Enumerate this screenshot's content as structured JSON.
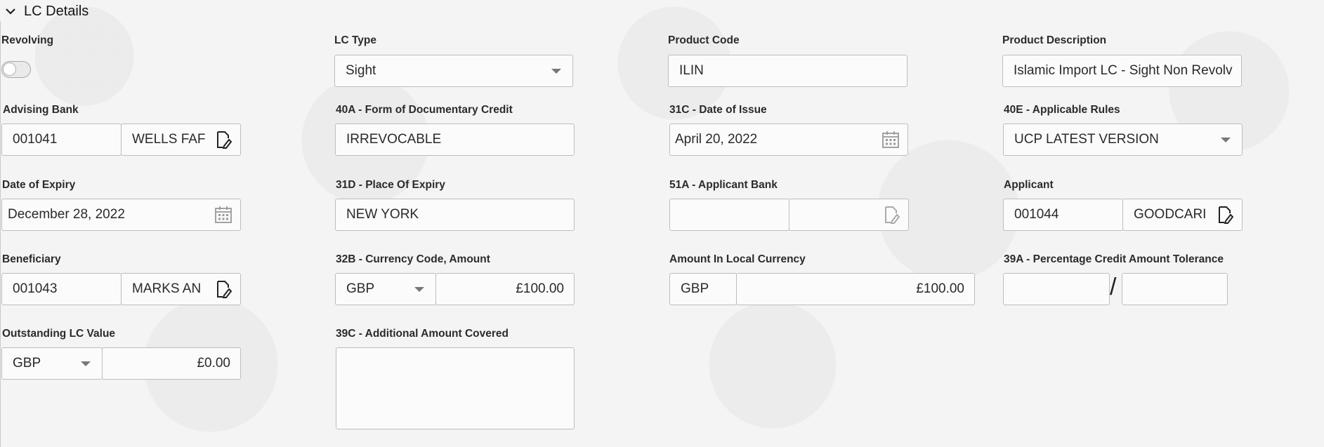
{
  "section": {
    "title": "LC Details"
  },
  "fields": {
    "revolving": {
      "label": "Revolving",
      "value": "off"
    },
    "lc_type": {
      "label": "LC Type",
      "value": "Sight"
    },
    "product_code": {
      "label": "Product Code",
      "value": "ILIN"
    },
    "product_description": {
      "label": "Product Description",
      "value": "Islamic Import LC - Sight Non Revolv"
    },
    "advising_bank": {
      "label": "Advising Bank",
      "code": "001041",
      "name": "WELLS FAF"
    },
    "form_of_credit": {
      "label": "40A - Form of Documentary Credit",
      "value": "IRREVOCABLE"
    },
    "date_of_issue": {
      "label": "31C - Date of Issue",
      "value": "April 20, 2022"
    },
    "applicable_rules": {
      "label": "40E - Applicable Rules",
      "value": "UCP LATEST VERSION"
    },
    "date_of_expiry": {
      "label": "Date of Expiry",
      "value": "December 28, 2022"
    },
    "place_of_expiry": {
      "label": "31D - Place Of Expiry",
      "value": "NEW YORK"
    },
    "applicant_bank": {
      "label": "51A - Applicant Bank",
      "code": "",
      "name": ""
    },
    "applicant": {
      "label": "Applicant",
      "code": "001044",
      "name": "GOODCARI"
    },
    "beneficiary": {
      "label": "Beneficiary",
      "code": "001043",
      "name": "MARKS AN"
    },
    "currency_amount": {
      "label": "32B - Currency Code, Amount",
      "currency": "GBP",
      "amount": "£100.00"
    },
    "local_currency": {
      "label": "Amount In Local Currency",
      "currency": "GBP",
      "amount": "£100.00"
    },
    "tolerance": {
      "label": "39A - Percentage Credit Amount Tolerance",
      "plus": "",
      "separator": "/",
      "minus": ""
    },
    "outstanding": {
      "label": "Outstanding LC Value",
      "currency": "GBP",
      "amount": "£0.00"
    },
    "additional_amount": {
      "label": "39C - Additional Amount Covered",
      "value": ""
    }
  }
}
